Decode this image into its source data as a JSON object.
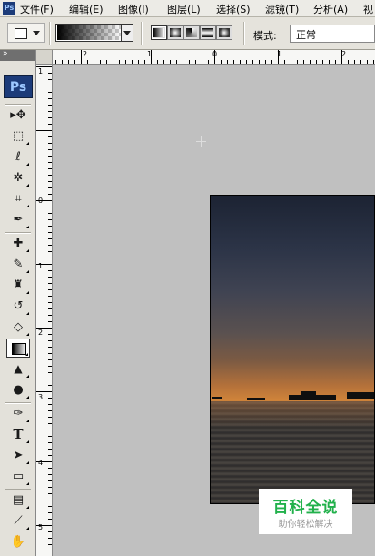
{
  "app": {
    "logo_small": "Ps",
    "logo_tool": "Ps"
  },
  "menu": [
    {
      "label": "文件(F)"
    },
    {
      "label": "编辑(E)"
    },
    {
      "label": "图像(I)"
    },
    {
      "label": "图层(L)"
    },
    {
      "label": "选择(S)"
    },
    {
      "label": "滤镜(T)"
    },
    {
      "label": "分析(A)"
    },
    {
      "label": "视"
    }
  ],
  "options": {
    "tool_preset_icon": "gradient-tool-preset-icon",
    "gradient_types": [
      "linear",
      "radial",
      "angle",
      "reflected",
      "diamond"
    ],
    "active_gradient_type": "linear",
    "mode_label": "模式:",
    "mode_value": "正常"
  },
  "toolbox": {
    "collapse_glyph": "»",
    "tools": [
      {
        "name": "move-tool",
        "glyph": "▸✥"
      },
      {
        "name": "marquee-tool",
        "glyph": "⬚"
      },
      {
        "name": "lasso-tool",
        "glyph": "ℓ"
      },
      {
        "name": "magic-wand-tool",
        "glyph": "✲"
      },
      {
        "name": "crop-tool",
        "glyph": "⌗"
      },
      {
        "name": "eyedropper-tool",
        "glyph": "✒"
      },
      {
        "name": "healing-brush-tool",
        "glyph": "✚"
      },
      {
        "name": "brush-tool",
        "glyph": "✎"
      },
      {
        "name": "clone-stamp-tool",
        "glyph": "♜"
      },
      {
        "name": "history-brush-tool",
        "glyph": "↺"
      },
      {
        "name": "eraser-tool",
        "glyph": "◇"
      },
      {
        "name": "gradient-tool",
        "glyph": ""
      },
      {
        "name": "blur-tool",
        "glyph": "💧"
      },
      {
        "name": "dodge-tool",
        "glyph": "●"
      },
      {
        "name": "pen-tool",
        "glyph": "✑"
      },
      {
        "name": "type-tool",
        "glyph": "T"
      },
      {
        "name": "path-selection-tool",
        "glyph": "➤"
      },
      {
        "name": "shape-tool",
        "glyph": "▭"
      },
      {
        "name": "notes-tool",
        "glyph": "▤"
      },
      {
        "name": "eyedropper2-tool",
        "glyph": "⟋"
      },
      {
        "name": "hand-tool",
        "glyph": "✋"
      },
      {
        "name": "zoom-tool",
        "glyph": "🔍"
      }
    ],
    "selected": "gradient-tool"
  },
  "rulers": {
    "horizontal": [
      "2",
      "1",
      "0",
      "1",
      "2"
    ],
    "vertical": [
      "1",
      "0",
      "1",
      "2",
      "3",
      "4",
      "5"
    ]
  },
  "watermark": {
    "title": "百科全说",
    "subtitle": "助你轻松解决"
  },
  "colors": {
    "watermark_green": "#22b14c",
    "ps_blue": "#1c3b79"
  }
}
